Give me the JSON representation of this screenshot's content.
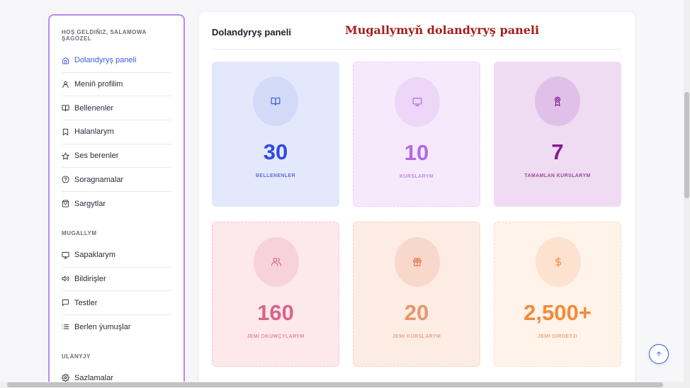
{
  "sidebar": {
    "greeting": "HOŞ GELDIÑIZ, SALAMOWA ŞAGÖZEL",
    "items": [
      {
        "label": "Dolandyryş paneli",
        "icon": "home-icon"
      },
      {
        "label": "Meniň profilim",
        "icon": "user-icon"
      },
      {
        "label": "Bellenenler",
        "icon": "book-open-icon"
      },
      {
        "label": "Halanlarym",
        "icon": "bookmark-icon"
      },
      {
        "label": "Ses berenler",
        "icon": "star-icon"
      },
      {
        "label": "Soragnamalar",
        "icon": "help-circle-icon"
      },
      {
        "label": "Sargytlar",
        "icon": "shopping-bag-icon"
      }
    ],
    "section_teacher": "MUGALLYM",
    "teacher_items": [
      {
        "label": "Sapaklarym",
        "icon": "monitor-icon"
      },
      {
        "label": "Bildirişler",
        "icon": "volume-icon"
      },
      {
        "label": "Testler",
        "icon": "message-square-icon"
      },
      {
        "label": "Berlen ýumuşlar",
        "icon": "list-icon"
      }
    ],
    "section_account": "ULANYJY",
    "account_items": [
      {
        "label": "Sazlamalar",
        "icon": "settings-icon"
      }
    ]
  },
  "main": {
    "title": "Dolandyryş paneli",
    "subtitle": "Mugallymyň dolandyryş paneli",
    "cards": [
      {
        "value": "30",
        "label": "BELLENENLER",
        "icon": "book-open-icon",
        "bg": "#e4e8fc",
        "circle": "#d3daf8",
        "color": "#2f4ae0",
        "labelColor": "#5a6fd9",
        "iconColor": "#3b5bdb"
      },
      {
        "value": "10",
        "label": "KURSLARYM",
        "icon": "monitor-icon",
        "bg": "#f6e9fc",
        "circle": "#edd6f8",
        "color": "#b06ae6",
        "labelColor": "#c28be8",
        "iconColor": "#b06ae6"
      },
      {
        "value": "7",
        "label": "TAMAMLAN KURSLARYM",
        "icon": "award-icon",
        "bg": "#efdcf2",
        "circle": "#e0c0e9",
        "color": "#8a1b8f",
        "labelColor": "#9a4aa0",
        "iconColor": "#8a1b8f"
      },
      {
        "value": "160",
        "label": "JEMI OKUWÇYLARYM",
        "icon": "users-icon",
        "bg": "#fde8ec",
        "circle": "#f8d2da",
        "color": "#d9658a",
        "labelColor": "#e08aa5",
        "iconColor": "#d9658a"
      },
      {
        "value": "20",
        "label": "JEMI KURSLARYM",
        "icon": "gift-icon",
        "bg": "#fcece4",
        "circle": "#f7d8ca",
        "color": "#e8966e",
        "labelColor": "#eba789",
        "iconColor": "#e07a4f"
      },
      {
        "value": "2,500+",
        "label": "JEMI GIRDEÝJI",
        "icon": "dollar-icon",
        "bg": "#fff3ea",
        "circle": "#fde2cf",
        "color": "#f48a3a",
        "labelColor": "#f4a470",
        "iconColor": "#f48a3a"
      }
    ]
  }
}
